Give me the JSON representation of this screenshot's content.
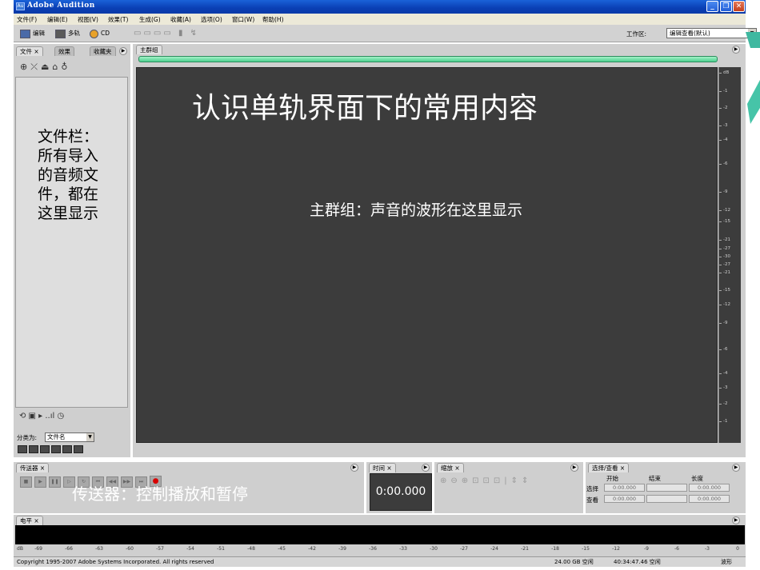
{
  "window": {
    "title": "Adobe Audition",
    "app_icon": "Au"
  },
  "menu": [
    "文件(F)",
    "编辑(E)",
    "视图(V)",
    "效果(T)",
    "生成(G)",
    "收藏(A)",
    "选项(O)",
    "窗口(W)",
    "帮助(H)"
  ],
  "toolbar": {
    "modes": [
      "编辑",
      "多轨",
      "CD"
    ],
    "workspace_label": "工作区:",
    "workspace_value": "编辑查看(默认)"
  },
  "files_panel": {
    "tabs": [
      "文件",
      "效果",
      "收藏夹"
    ],
    "note": "文件栏：\n所有导入\n的音频文\n件，都在\n这里显示",
    "sort_label": "分类为:",
    "sort_value": "文件名"
  },
  "main_panel": {
    "tab": "主群组",
    "title": "认识单轨界面下的常用内容",
    "note": "主群组：声音的波形在这里显示",
    "ruler_labels": [
      "dB",
      "-1",
      "-2",
      "-3",
      "-4",
      "-6",
      "-9",
      "-12",
      "-15",
      "-21",
      "-27",
      "-30",
      "-27",
      "-21",
      "-15",
      "-12",
      "-9",
      "-6",
      "-4",
      "-3",
      "-2",
      "-1"
    ]
  },
  "transport_panel": {
    "tab": "传送器",
    "note": "传送器：控制播放和暂停"
  },
  "time_panel": {
    "tab": "时间",
    "time": "0:00.000"
  },
  "zoom_panel": {
    "tab": "缩放"
  },
  "selection_panel": {
    "tab": "选择/查看",
    "headers": [
      "开始",
      "结束",
      "长度"
    ],
    "rows": [
      {
        "label": "选择",
        "start": "0:00.000",
        "end": "",
        "length": "0:00.000"
      },
      {
        "label": "查看",
        "start": "0:00.000",
        "end": "",
        "length": "0:00.000"
      }
    ]
  },
  "level_panel": {
    "tab": "电平",
    "scale": [
      "dB",
      "-69",
      "-66",
      "-63",
      "-60",
      "-57",
      "-54",
      "-51",
      "-48",
      "-45",
      "-42",
      "-39",
      "-36",
      "-33",
      "-30",
      "-27",
      "-24",
      "-21",
      "-18",
      "-15",
      "-12",
      "-9",
      "-6",
      "-3",
      "0"
    ]
  },
  "status": {
    "copyright": "Copyright 1995-2007 Adobe Systems Incorporated. All rights reserved",
    "disk_space": "24.00 GB 空闲",
    "time_free": "40:34:47.46 空闲",
    "view_mode": "波形"
  },
  "colors": {
    "titlebar": "#0a3fb4",
    "panel_bg": "#cfcfcf",
    "editor_bg": "#3c3c3c",
    "green_bar": "#4ccf8e"
  }
}
